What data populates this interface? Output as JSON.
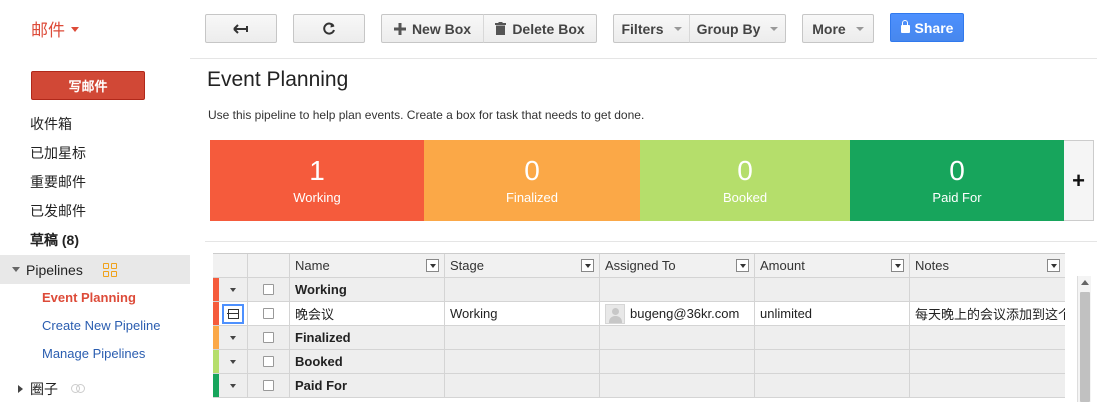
{
  "sidebar": {
    "app_switch": "邮件",
    "compose": "写邮件",
    "folders": [
      {
        "label": "收件箱",
        "bold": false
      },
      {
        "label": "已加星标",
        "bold": false
      },
      {
        "label": "重要邮件",
        "bold": false
      },
      {
        "label": "已发邮件",
        "bold": false
      },
      {
        "label": "草稿 (8)",
        "bold": true
      }
    ],
    "pipelines_label": "Pipelines",
    "pipeline_items": [
      {
        "label": "Event Planning",
        "active": true
      },
      {
        "label": "Create New Pipeline",
        "active": false
      },
      {
        "label": "Manage Pipelines",
        "active": false
      }
    ],
    "circles_label": "圈子"
  },
  "toolbar": {
    "new_box": "New Box",
    "delete_box": "Delete Box",
    "filters": "Filters",
    "group_by": "Group By",
    "more": "More",
    "share": "Share"
  },
  "pipeline": {
    "title": "Event Planning",
    "description": "Use this pipeline to help plan events. Create a box for task that needs to get done."
  },
  "stages": [
    {
      "count": "1",
      "name": "Working",
      "color": "#f55b3c"
    },
    {
      "count": "0",
      "name": "Finalized",
      "color": "#fba847"
    },
    {
      "count": "0",
      "name": "Booked",
      "color": "#b5de6b"
    },
    {
      "count": "0",
      "name": "Paid For",
      "color": "#17a55c"
    }
  ],
  "table": {
    "columns": [
      "Name",
      "Stage",
      "Assigned To",
      "Amount",
      "Notes"
    ],
    "groups": [
      {
        "name": "Working",
        "color": "#f55b3c",
        "rows": [
          {
            "name": "晚会议",
            "stage": "Working",
            "assigned": "bugeng@36kr.com",
            "amount": "unlimited",
            "notes": "每天晚上的会议添加到这个"
          }
        ]
      },
      {
        "name": "Finalized",
        "color": "#fba847",
        "rows": []
      },
      {
        "name": "Booked",
        "color": "#b5de6b",
        "rows": []
      },
      {
        "name": "Paid For",
        "color": "#17a55c",
        "rows": []
      }
    ]
  }
}
